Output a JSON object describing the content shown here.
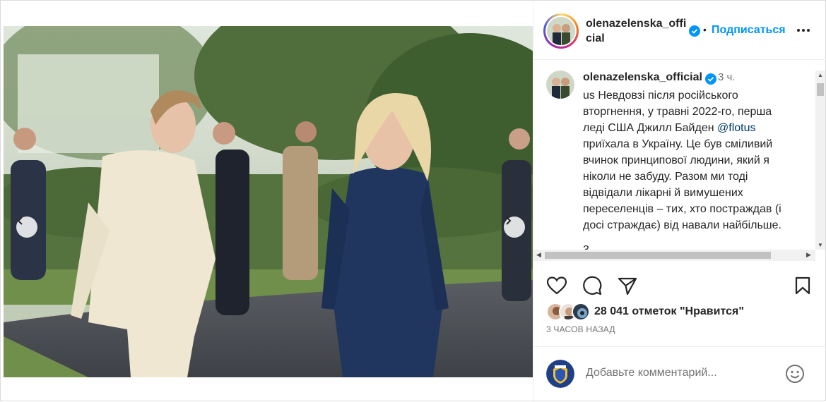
{
  "post": {
    "username": "olenazelenska_official",
    "header_username": "olenazelenska_official",
    "follow_label": "Подписаться",
    "separator": "•",
    "time": "3 ч.",
    "caption_lines": [
      "us Невдовзі після російського",
      "вторгнення, у травні 2022-го, перша",
      "леді США Джилл Байден ",
      "приїхала в Україну. Це був сміливий",
      "вчинок принципової людини, який я",
      "ніколи не забуду. Разом ми тоді",
      "відвідали лікарні й вимушених",
      "переселенців – тих, хто постраждав (і",
      "досі страждає) від навали найбільше."
    ],
    "mention": "@flotus",
    "caption_cutoff": "3",
    "likes_text": "28 041 отметок \"Нравится\"",
    "time_ago": "3 ЧАСОВ НАЗАД",
    "comment_placeholder": "Добавьте комментарий...",
    "carousel": {
      "total": 10,
      "active": 1
    }
  },
  "icons": {
    "more": "more-horizontal-icon",
    "like": "heart-icon",
    "comment": "comment-icon",
    "share": "share-icon",
    "save": "bookmark-icon",
    "emoji": "emoji-icon",
    "verified": "verified-badge-icon",
    "prev": "chevron-left-icon",
    "next": "chevron-right-icon"
  },
  "colors": {
    "accent": "#0095f6",
    "text": "#262626",
    "muted": "#737373",
    "verified": "#0095f6"
  }
}
